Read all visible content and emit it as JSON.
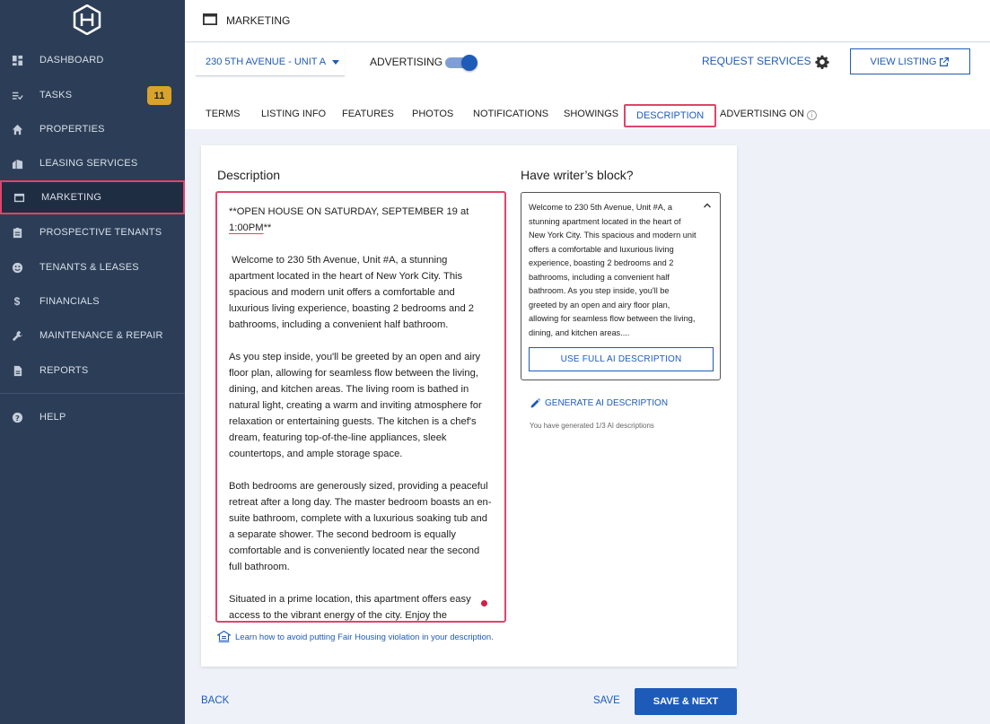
{
  "sidebar": {
    "items": [
      {
        "label": "DASHBOARD",
        "icon": "dashboard-icon"
      },
      {
        "label": "TASKS",
        "icon": "tasks-icon",
        "badge": "11"
      },
      {
        "label": "PROPERTIES",
        "icon": "home-icon"
      },
      {
        "label": "LEASING SERVICES",
        "icon": "buildings-icon"
      },
      {
        "label": "MARKETING",
        "icon": "browser-window-icon",
        "active": true
      },
      {
        "label": "PROSPECTIVE TENANTS",
        "icon": "clipboard-icon"
      },
      {
        "label": "TENANTS & LEASES",
        "icon": "smiley-icon"
      },
      {
        "label": "FINANCIALS",
        "icon": "dollar-icon"
      },
      {
        "label": "MAINTENANCE & REPAIR",
        "icon": "wrench-icon"
      },
      {
        "label": "REPORTS",
        "icon": "document-icon"
      },
      {
        "label": "HELP",
        "icon": "help-icon"
      }
    ]
  },
  "header": {
    "title": "MARKETING"
  },
  "toolbar": {
    "property": "230 5TH AVENUE - UNIT A",
    "advertising_label": "ADVERTISING",
    "advertising_on": true,
    "request_services": "REQUEST SERVICES",
    "view_listing": "VIEW LISTING"
  },
  "tabs": [
    {
      "label": "TERMS"
    },
    {
      "label": "LISTING INFO"
    },
    {
      "label": "FEATURES"
    },
    {
      "label": "PHOTOS"
    },
    {
      "label": "NOTIFICATIONS"
    },
    {
      "label": "SHOWINGS"
    },
    {
      "label": "DESCRIPTION",
      "active": true
    },
    {
      "label": "ADVERTISING ON"
    }
  ],
  "description": {
    "title": "Description",
    "line1": "**OPEN HOUSE ON SATURDAY, SEPTEMBER 19 at",
    "line2": "1:00PM",
    "line2_rest": "**",
    "body": " Welcome to 230 5th Avenue, Unit #A, a stunning apartment located in the heart of New York City. This spacious and modern unit offers a comfortable and luxurious living experience, boasting 2 bedrooms and 2 bathrooms, including a convenient half bathroom.\n\nAs you step inside, you'll be greeted by an open and airy floor plan, allowing for seamless flow between the living, dining, and kitchen areas. The living room is bathed in natural light, creating a warm and inviting atmosphere for relaxation or entertaining guests. The kitchen is a chef's dream, featuring top-of-the-line appliances, sleek countertops, and ample storage space.\n\nBoth bedrooms are generously sized, providing a peaceful retreat after a long day. The master bedroom boasts an en-suite bathroom, complete with a luxurious soaking tub and a separate shower. The second bedroom is equally comfortable and is conveniently located near the second full bathroom.\n\nSituated in a prime location, this apartment offers easy access to the vibrant energy of the city. Enjoy the",
    "fair_housing_link": "Learn how to avoid putting Fair Housing violation in your description."
  },
  "writers_block": {
    "title": "Have writer’s block?",
    "preview": "Welcome to 230 5th Avenue, Unit #A, a stunning apartment located in the heart of New York City. This spacious and modern unit offers a comfortable and luxurious living experience, boasting 2 bedrooms and 2 bathrooms, including a convenient half bathroom. As you step inside, you'll be greeted by an open and airy floor plan, allowing for seamless flow between the living, dining, and kitchen areas....",
    "use_full": "USE FULL AI DESCRIPTION",
    "generate": "GENERATE AI DESCRIPTION",
    "note": "You have generated 1/3 AI descriptions"
  },
  "footer": {
    "back": "BACK",
    "save": "SAVE",
    "save_next": "SAVE & NEXT"
  },
  "colors": {
    "sidebar_bg": "#2c3e57",
    "accent_blue": "#1e5bb8",
    "highlight_red": "#e0446a",
    "badge_gold": "#d9a22a"
  }
}
